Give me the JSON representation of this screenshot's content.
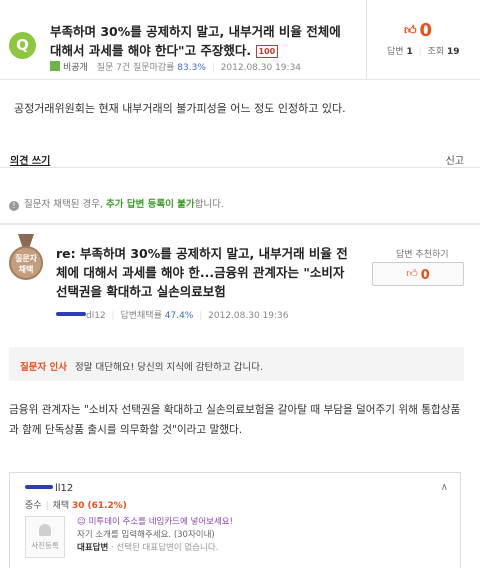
{
  "question": {
    "badge": "Q",
    "title": "부족하며 30%를 공제하지 말고, 내부거래 비율 전체에 대해서 과세를 해야 한다\"고 주장했다.",
    "badge_100": "100",
    "author": "비공개",
    "meta_label": "질문 7건 질문마감률",
    "meta_rate": "83.3%",
    "date": "2012.08.30 19:34",
    "likes": "0",
    "answers_label": "답변",
    "answers_count": "1",
    "views_label": "조회",
    "views_count": "19",
    "body": "공정거래위원회는 현재 내부거래의 불가피성을 어느 정도 인정하고 있다."
  },
  "opinion_bar": {
    "opinion_label": "의견 쓰기",
    "report_label": "신고"
  },
  "notice": {
    "text_before": "질문자 채택된 경우,",
    "highlight": "추가 답변 등록이 불가",
    "text_after": "합니다."
  },
  "answer": {
    "medal_line1": "질문자",
    "medal_line2": "채택",
    "title": "re: 부족하며 30%를 공제하지 말고, 내부거래 비율 전체에 대해서 과세를 해야 한...금융위 관계자는 \"소비자 선택권을 확대하고 실손의료보험",
    "author_suffix": "dl12",
    "meta_label": "답변채택률",
    "meta_rate": "47.4%",
    "date": "2012.08.30 19:36",
    "recommend_label": "답변 추천하기",
    "recommend_count": "0",
    "thanks_label": "질문자 인사",
    "thanks_text": "정말 대단해요! 당신의 지식에 감탄하고 갑니다.",
    "body": "금융위 관계자는 \"소비자 선택권을 확대하고 실손의료보험을 갈아탈 때 부담을 덜어주기 위해 통합상품과 함께 단독상품 출시를 의무화할 것\"이라고 말했다."
  },
  "profile": {
    "name_suffix": "ll12",
    "grade_label": "중수",
    "adopt_label": "채택",
    "adopt_count": "30",
    "adopt_rate": "(61.2%)",
    "photo_label": "사진등록",
    "address_line": "미투데이 주소를 네임카드에 넣어보세요!",
    "intro_line": "자기 소개를 입력해주세요. (30자이내)",
    "rep_label": "대표답변",
    "rep_text": "· 선택된 대표답변이 없습니다."
  },
  "colors": {
    "accent_orange": "#e8501a",
    "question_badge": "#8dc63f",
    "link_blue": "#3a6cc6",
    "notice_green": "#3c9d29"
  }
}
